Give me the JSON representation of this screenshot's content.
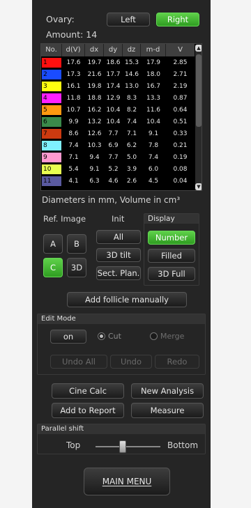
{
  "ovary": {
    "label": "Ovary:",
    "left": "Left",
    "right": "Right"
  },
  "amount": "Amount: 14",
  "table": {
    "headers": [
      "No.",
      "d(V)",
      "dx",
      "dy",
      "dz",
      "m-d",
      "V"
    ],
    "rows": [
      {
        "no": "1",
        "color": "#ff1010",
        "cells": [
          "17.6",
          "19.7",
          "18.6",
          "15.3",
          "17.9",
          "2.85"
        ]
      },
      {
        "no": "2",
        "color": "#1a4cff",
        "cells": [
          "17.3",
          "21.6",
          "17.7",
          "14.6",
          "18.0",
          "2.71"
        ]
      },
      {
        "no": "3",
        "color": "#ffff10",
        "cells": [
          "16.1",
          "19.8",
          "17.4",
          "13.0",
          "16.7",
          "2.19"
        ]
      },
      {
        "no": "4",
        "color": "#ff20ff",
        "cells": [
          "11.8",
          "18.8",
          "12.9",
          "8.3",
          "13.3",
          "0.87"
        ]
      },
      {
        "no": "5",
        "color": "#ff9910",
        "cells": [
          "10.7",
          "16.2",
          "10.4",
          "8.2",
          "11.6",
          "0.64"
        ]
      },
      {
        "no": "6",
        "color": "#3a8a4a",
        "cells": [
          "9.9",
          "13.2",
          "10.4",
          "7.4",
          "10.4",
          "0.51"
        ]
      },
      {
        "no": "7",
        "color": "#cc3a10",
        "cells": [
          "8.6",
          "12.6",
          "7.7",
          "7.1",
          "9.1",
          "0.33"
        ]
      },
      {
        "no": "8",
        "color": "#7ff0ff",
        "cells": [
          "7.4",
          "10.3",
          "6.9",
          "6.2",
          "7.8",
          "0.21"
        ]
      },
      {
        "no": "9",
        "color": "#ff9ad0",
        "cells": [
          "7.1",
          "9.4",
          "7.7",
          "5.0",
          "7.4",
          "0.19"
        ]
      },
      {
        "no": "10",
        "color": "#e8ff50",
        "cells": [
          "5.4",
          "9.1",
          "5.2",
          "3.9",
          "6.0",
          "0.08"
        ]
      },
      {
        "no": "11",
        "color": "#5a5aa0",
        "cells": [
          "4.1",
          "6.3",
          "4.6",
          "2.6",
          "4.5",
          "0.04"
        ]
      }
    ]
  },
  "units_note": "Diameters in mm, Volume in cm³",
  "ref_image": {
    "label": "Ref. Image",
    "a": "A",
    "b": "B",
    "c": "C",
    "d3": "3D"
  },
  "init": {
    "label": "Init",
    "all": "All",
    "tilt": "3D tilt",
    "sect": "Sect. Plan."
  },
  "display": {
    "label": "Display",
    "number": "Number",
    "filled": "Filled",
    "full": "3D Full"
  },
  "add_follicle": "Add follicle manually",
  "edit_mode": {
    "title": "Edit Mode",
    "on": "on",
    "cut": "Cut",
    "merge": "Merge",
    "undo_all": "Undo All",
    "undo": "Undo",
    "redo": "Redo"
  },
  "actions": {
    "cine": "Cine Calc",
    "new_analysis": "New Analysis",
    "add_report": "Add to Report",
    "measure": "Measure"
  },
  "parallel": {
    "title": "Parallel shift",
    "top": "Top",
    "bottom": "Bottom",
    "position": 0.42
  },
  "main_menu": "MAIN MENU",
  "colors": {
    "panel": "#252525",
    "accent": "#44bb33"
  }
}
